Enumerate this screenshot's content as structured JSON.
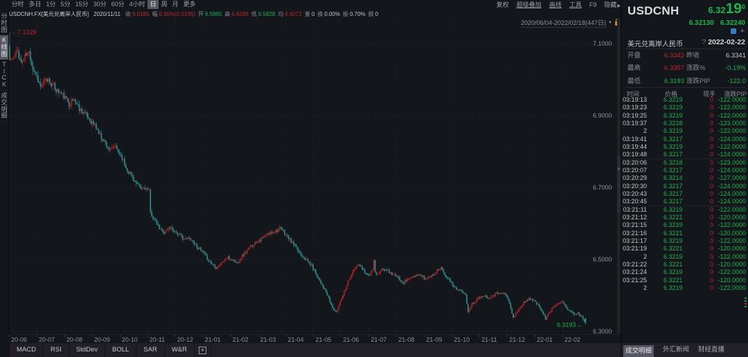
{
  "toolbar": {
    "periods": [
      "分时",
      "多日",
      "1分",
      "5分",
      "15分",
      "30分",
      "60分",
      "4小时",
      "日",
      "周",
      "月",
      "更多"
    ],
    "selected_period": "日",
    "menus": [
      "复权",
      "超级叠加",
      "画线",
      "工具",
      "F9",
      "隐藏"
    ],
    "underlined_menus": [
      "超级叠加",
      "画线",
      "工具"
    ],
    "menu_arrow": "▶",
    "info": {
      "symbol": "USDCNH.FX[美元兑离岸人民币]",
      "date": "2020/11/11",
      "fields": [
        {
          "label": "收",
          "value": "6.6185",
          "color": "red"
        },
        {
          "label": "幅",
          "value": "0.30%(0.0195)",
          "color": "red"
        },
        {
          "label": "开",
          "value": "6.5985",
          "color": "green"
        },
        {
          "label": "高",
          "value": "6.6288",
          "color": "red"
        },
        {
          "label": "低",
          "value": "6.5828",
          "color": "green"
        },
        {
          "label": "均",
          "value": "6.6072",
          "color": "red"
        },
        {
          "label": "量",
          "value": "0",
          "color": "white"
        },
        {
          "label": "换",
          "value": "0.00%",
          "color": "white"
        },
        {
          "label": "振",
          "value": "0.70%",
          "color": "white"
        },
        {
          "label": "额",
          "value": "0",
          "color": "white"
        }
      ]
    },
    "range": "2020/06/04-2022/02/18(447日)",
    "range_arrow": "▼"
  },
  "sidebar": {
    "items": [
      {
        "label": "分时图",
        "selected": false
      },
      {
        "label": "K线图",
        "selected": true
      },
      {
        "label": "TICK",
        "selected": false
      },
      {
        "label": "成交明细",
        "selected": false
      }
    ]
  },
  "chart_data": {
    "type": "candlestick",
    "symbol": "USDCNH.FX",
    "title": "美元兑离岸人民币",
    "bar_count": 447,
    "date_range": "2020/06/04-2022/02/18(447日)",
    "x_labels": [
      "20-06",
      "20-07",
      "20-08",
      "20-09",
      "20-10",
      "20-11",
      "20-12",
      "21-01",
      "21-02",
      "21-03",
      "21-04",
      "21-05",
      "21-06",
      "21-07",
      "21-08",
      "21-09",
      "21-10",
      "21-11",
      "21-12",
      "22-01",
      "22-02"
    ],
    "y_tick_labels": [
      "7.1000",
      "6.9000",
      "6.7000",
      "6.5000",
      "6.3000"
    ],
    "y_tick_values": [
      7.1,
      6.9,
      6.7,
      6.5,
      6.3
    ],
    "ylim": [
      6.2923,
      7.1692
    ],
    "period_high": {
      "value": 7.1329,
      "label": "7.1329",
      "arrow": "←"
    },
    "period_low": {
      "value": 6.3193,
      "label": "6.3193",
      "arrow": "→"
    },
    "last_close": 6.3219,
    "first_open": 7.095,
    "close_waypoints": [
      [
        0,
        7.055
      ],
      [
        3,
        7.06
      ],
      [
        6,
        7.08
      ],
      [
        9,
        7.045
      ],
      [
        12,
        7.065
      ],
      [
        15,
        7.075
      ],
      [
        18,
        7.03
      ],
      [
        21,
        7.01
      ],
      [
        24,
        6.978
      ],
      [
        27,
        6.995
      ],
      [
        30,
        7.0
      ],
      [
        33,
        6.985
      ],
      [
        36,
        6.972
      ],
      [
        39,
        6.963
      ],
      [
        42,
        6.952
      ],
      [
        46,
        6.934
      ],
      [
        50,
        6.944
      ],
      [
        54,
        6.92
      ],
      [
        58,
        6.905
      ],
      [
        62,
        6.888
      ],
      [
        66,
        6.873
      ],
      [
        70,
        6.845
      ],
      [
        74,
        6.825
      ],
      [
        78,
        6.8
      ],
      [
        81,
        6.815
      ],
      [
        84,
        6.8
      ],
      [
        87,
        6.785
      ],
      [
        90,
        6.755
      ],
      [
        94,
        6.735
      ],
      [
        98,
        6.71
      ],
      [
        102,
        6.695
      ],
      [
        105,
        6.7
      ],
      [
        108,
        6.688
      ],
      [
        109,
        6.63
      ],
      [
        113,
        6.605
      ],
      [
        116,
        6.585
      ],
      [
        120,
        6.575
      ],
      [
        124,
        6.59
      ],
      [
        128,
        6.578
      ],
      [
        132,
        6.565
      ],
      [
        136,
        6.556
      ],
      [
        140,
        6.558
      ],
      [
        144,
        6.54
      ],
      [
        148,
        6.525
      ],
      [
        152,
        6.508
      ],
      [
        156,
        6.49
      ],
      [
        160,
        6.478
      ],
      [
        164,
        6.49
      ],
      [
        168,
        6.505
      ],
      [
        172,
        6.5
      ],
      [
        176,
        6.49
      ],
      [
        180,
        6.51
      ],
      [
        184,
        6.525
      ],
      [
        188,
        6.54
      ],
      [
        192,
        6.552
      ],
      [
        196,
        6.56
      ],
      [
        200,
        6.57
      ],
      [
        204,
        6.578
      ],
      [
        207,
        6.582
      ],
      [
        210,
        6.585
      ],
      [
        214,
        6.568
      ],
      [
        218,
        6.55
      ],
      [
        222,
        6.53
      ],
      [
        226,
        6.512
      ],
      [
        230,
        6.498
      ],
      [
        234,
        6.482
      ],
      [
        238,
        6.455
      ],
      [
        242,
        6.43
      ],
      [
        246,
        6.4
      ],
      [
        250,
        6.365
      ],
      [
        253,
        6.352
      ],
      [
        256,
        6.385
      ],
      [
        259,
        6.41
      ],
      [
        262,
        6.44
      ],
      [
        266,
        6.468
      ],
      [
        270,
        6.485
      ],
      [
        274,
        6.47
      ],
      [
        278,
        6.455
      ],
      [
        281,
        6.468
      ],
      [
        282,
        6.502
      ],
      [
        283,
        6.462
      ],
      [
        285,
        6.458
      ],
      [
        289,
        6.473
      ],
      [
        293,
        6.468
      ],
      [
        297,
        6.458
      ],
      [
        301,
        6.448
      ],
      [
        305,
        6.435
      ],
      [
        309,
        6.448
      ],
      [
        313,
        6.45
      ],
      [
        318,
        6.458
      ],
      [
        322,
        6.445
      ],
      [
        328,
        6.458
      ],
      [
        334,
        6.478
      ],
      [
        339,
        6.448
      ],
      [
        344,
        6.425
      ],
      [
        350,
        6.41
      ],
      [
        353,
        6.4
      ],
      [
        355,
        6.357
      ],
      [
        358,
        6.376
      ],
      [
        362,
        6.39
      ],
      [
        366,
        6.4
      ],
      [
        371,
        6.394
      ],
      [
        377,
        6.405
      ],
      [
        382,
        6.41
      ],
      [
        386,
        6.39
      ],
      [
        390,
        6.338
      ],
      [
        394,
        6.36
      ],
      [
        398,
        6.378
      ],
      [
        402,
        6.392
      ],
      [
        406,
        6.385
      ],
      [
        410,
        6.37
      ],
      [
        413,
        6.352
      ],
      [
        415,
        6.335
      ],
      [
        418,
        6.352
      ],
      [
        421,
        6.368
      ],
      [
        424,
        6.378
      ],
      [
        428,
        6.385
      ],
      [
        431,
        6.366
      ],
      [
        434,
        6.355
      ],
      [
        437,
        6.348
      ],
      [
        440,
        6.352
      ],
      [
        442,
        6.344
      ],
      [
        444,
        6.336
      ],
      [
        446,
        6.3219
      ]
    ],
    "up_color": "#b02428",
    "down_color": "#2f8c8a",
    "grid_color": "#23262c",
    "noise": 0.004,
    "seed": 11
  },
  "quote": {
    "symbol": "USDCNH",
    "price_int": "6.32",
    "price_big": "19",
    "price_sup": "0",
    "bid": "6.32130",
    "ask": "6.32240",
    "name": "美元兑离岸人民币",
    "help": "?",
    "date": "2022-02-22",
    "stats": [
      [
        {
          "label": "开盘",
          "value": "6.3342",
          "color": "red"
        },
        {
          "label": "昨收",
          "value": "6.3341",
          "color": "white"
        }
      ],
      [
        {
          "label": "最高",
          "value": "6.3357",
          "color": "red"
        },
        {
          "label": "涨跌%",
          "value": "-0.19%",
          "color": "green"
        }
      ],
      [
        {
          "label": "最低",
          "value": "6.3193",
          "color": "green"
        },
        {
          "label": "涨跌PIP",
          "value": "-122.0",
          "color": "green"
        }
      ]
    ],
    "table": {
      "headers": [
        "时间",
        "价格",
        "现手",
        "涨跌PIP"
      ],
      "rows": [
        [
          "03:19:13",
          "6.3219",
          "0",
          "-122.0000"
        ],
        [
          "03:19:23",
          "6.3219",
          "0",
          "-122.0000"
        ],
        [
          "03:19:25",
          "6.3219",
          "0",
          "-122.0000"
        ],
        [
          "03:19:37",
          "6.3218",
          "0",
          "-123.0000"
        ],
        [
          "2",
          "6.3219",
          "0",
          "-122.0000"
        ],
        [
          "03:19:41",
          "6.3217",
          "0",
          "-124.0000"
        ],
        [
          "03:19:44",
          "6.3219",
          "0",
          "-122.0000"
        ],
        [
          "03:19:48",
          "6.3217",
          "0",
          "-124.0000"
        ],
        [
          "03:20:06",
          "6.3218",
          "0",
          "-123.0000"
        ],
        [
          "03:20:07",
          "6.3217",
          "0",
          "-124.0000"
        ],
        [
          "03:20:29",
          "6.3214",
          "0",
          "-127.0000"
        ],
        [
          "03:20:30",
          "6.3217",
          "0",
          "-124.0000"
        ],
        [
          "03:20:43",
          "6.3217",
          "0",
          "-124.0000"
        ],
        [
          "03:20:45",
          "6.3217",
          "0",
          "-124.0000"
        ],
        [
          "03:21:11",
          "6.3219",
          "0",
          "-122.0000"
        ],
        [
          "03:21:12",
          "6.3221",
          "0",
          "-120.0000"
        ],
        [
          "03:21:15",
          "6.3219",
          "0",
          "-122.0000"
        ],
        [
          "03:21:16",
          "6.3221",
          "0",
          "-120.0000"
        ],
        [
          "03:21:17",
          "6.3219",
          "0",
          "-122.0000"
        ],
        [
          "03:21:19",
          "6.3221",
          "0",
          "-120.0000"
        ],
        [
          "2",
          "6.3219",
          "0",
          "-122.0000"
        ],
        [
          "03:21:22",
          "6.3221",
          "0",
          "-120.0000"
        ],
        [
          "03:21:24",
          "6.3219",
          "0",
          "-122.0000"
        ],
        [
          "03:21:25",
          "6.3221",
          "0",
          "-120.0000"
        ],
        [
          "2",
          "6.3219",
          "0",
          "-122.0000"
        ]
      ]
    }
  },
  "bottom": {
    "indicators": [
      "MACD",
      "RSI",
      "StdDev",
      "BOLL",
      "SAR",
      "W&R"
    ],
    "add_label": "+",
    "tabs": [
      {
        "label": "成交明细",
        "active": true
      },
      {
        "label": "外汇新闻",
        "active": false
      },
      {
        "label": "财经直播",
        "active": false
      }
    ]
  }
}
